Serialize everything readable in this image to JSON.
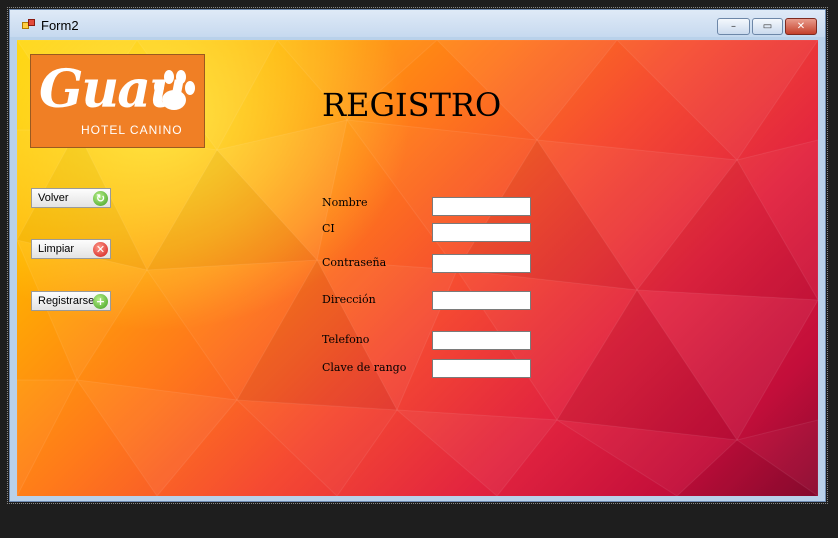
{
  "window": {
    "title": "Form2",
    "minimize": "–",
    "maximize": "▭",
    "close": "✕"
  },
  "logo": {
    "word": "Guau",
    "subtitle": "HOTEL CANINO"
  },
  "heading": "REGISTRO",
  "buttons": [
    {
      "label": "Volver",
      "icon": "refresh-icon",
      "glyph": "↻"
    },
    {
      "label": "Limpiar",
      "icon": "clear-icon",
      "glyph": "✕"
    },
    {
      "label": "Registrarse",
      "icon": "add-icon",
      "glyph": "+"
    }
  ],
  "fields": [
    {
      "label": "Nombre",
      "value": ""
    },
    {
      "label": "CI",
      "value": ""
    },
    {
      "label": "Contraseña",
      "value": ""
    },
    {
      "label": "Dirección",
      "value": ""
    },
    {
      "label": "Telefono",
      "value": ""
    },
    {
      "label": "Clave de rango",
      "value": ""
    }
  ],
  "colors": {
    "logo_bg": "#f07f25",
    "gradient_start": "#ffd100",
    "gradient_end": "#8c0a30"
  }
}
